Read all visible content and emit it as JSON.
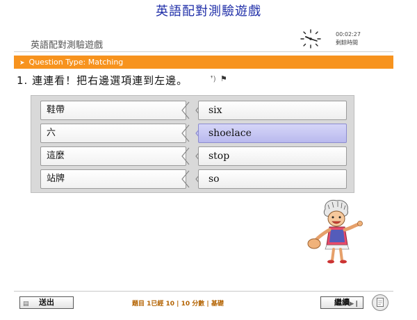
{
  "app_title": "英語配對測驗遊戲",
  "quiz": {
    "subtitle": "英語配對測驗遊戲",
    "timer": {
      "time": "00:02:27",
      "label": "剩餘時間"
    },
    "question_type": "Question Type: Matching",
    "question_text": "1. 連連看！把右邊選項連到左邊。"
  },
  "matching": {
    "left": [
      "鞋帶",
      "六",
      "這麼",
      "站牌"
    ],
    "right": [
      {
        "text": "six",
        "selected": false
      },
      {
        "text": "shoelace",
        "selected": true
      },
      {
        "text": "stop",
        "selected": false
      },
      {
        "text": "so",
        "selected": false
      }
    ]
  },
  "footer": {
    "exit_label": "送出",
    "status": "題目 1已經 10 | 10 分數 | 基礎",
    "continue_label": "繼續"
  },
  "colors": {
    "title": "#1f2ea8",
    "accent": "#f7931e",
    "selected": "#c7c7f2"
  },
  "icons": {
    "clock": "clock-icon",
    "audio": "audio-icon",
    "flag": "flag-icon",
    "exit": "list-icon",
    "continue": "play-next-icon",
    "document": "document-icon"
  }
}
